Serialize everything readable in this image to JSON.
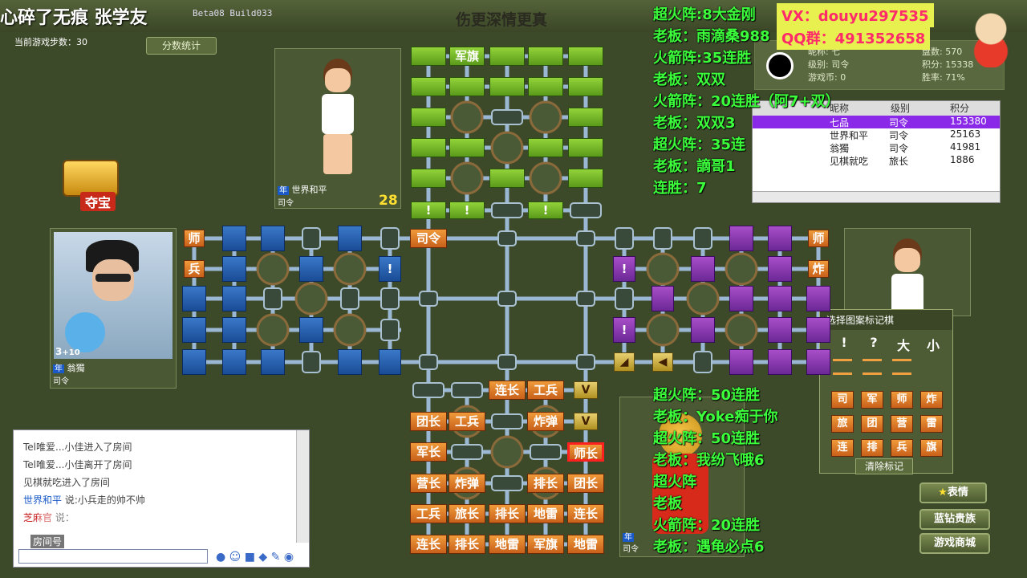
{
  "window": {
    "title_overlay": "心碎了无痕 张学友",
    "build": "Beta08 Build033",
    "slogan": "伤更深情更真"
  },
  "game": {
    "steps_label": "当前游戏步数：",
    "steps_value": "30",
    "score_button": "分数统计",
    "treasure_label": "夺宝"
  },
  "players": {
    "top": {
      "rank": "司令",
      "name": "世界和平",
      "badge": "年",
      "count": "28"
    },
    "left": {
      "rank": "司令",
      "name": "翁獨",
      "badge": "年",
      "level": "3",
      "plus": "+10"
    },
    "bottom": {
      "rank": "司令",
      "badge": "年"
    }
  },
  "profile": {
    "nick_label": "昵称",
    "rank_label": "级别",
    "rank_value": "司令",
    "coins_label": "游戏币",
    "coins_value": "0",
    "games_label": "盘数",
    "games_value": "570",
    "score_label": "积分",
    "score_value": "15338",
    "win_label": "胜率",
    "win_value": "71%",
    "badge_text": "七"
  },
  "player_list": {
    "headers": [
      "昵称",
      "级别",
      "积分"
    ],
    "rows": [
      {
        "name": "七品",
        "rank": "司令",
        "score": "153380"
      },
      {
        "name": "世界和平",
        "rank": "司令",
        "score": "25163"
      },
      {
        "name": "翁獨",
        "rank": "司令",
        "score": "41981"
      },
      {
        "name": "见棋就吃",
        "rank": "旅长",
        "score": "1886"
      }
    ]
  },
  "promo": {
    "vx": "VX：douyu297535",
    "qq": "QQ群：491352658"
  },
  "overlay_top": [
    "超火阵:8大金刚",
    "老板：雨滴桑988",
    "火箭阵:35连胜",
    "老板：双双",
    "火箭阵：20连胜（阿7+双）",
    "老板：双双3",
    "超火阵：35连",
    "老板：謫哥1",
    "连胜：7"
  ],
  "overlay_bottom": [
    "超火阵：50连胜",
    "老板：Yoke痴于你",
    "超火阵：50连胜",
    "老板：我纷飞哦6",
    "超火阵",
    "老板",
    "火箭阵：20连胜",
    "老板：遇龟必点6"
  ],
  "board": {
    "top_labels": {
      "flag": "军旗"
    },
    "marks": {
      "exclaim": "!",
      "question": "?"
    },
    "center_piece": "司令",
    "left_pieces": [
      "师",
      "兵"
    ],
    "right_pieces": [
      "师",
      "炸"
    ],
    "bottom_rows": [
      [
        "",
        "",
        "连长",
        "工兵",
        "v"
      ],
      [
        "团长",
        "工兵",
        "",
        "炸弹",
        "v"
      ],
      [
        "军长",
        "",
        "",
        "",
        "师长"
      ],
      [
        "营长",
        "炸弹",
        "",
        "排长",
        "团长"
      ],
      [
        "工兵",
        "旅长",
        "排长",
        "地雷",
        "连长"
      ],
      [
        "连长",
        "排长",
        "地雷",
        "军旗",
        "地雷"
      ]
    ]
  },
  "mark_panel": {
    "title": "选择图案标记棋",
    "row1": [
      "!",
      "?",
      "大",
      "小"
    ],
    "pieces": [
      "司",
      "军",
      "师",
      "炸",
      "旅",
      "团",
      "营",
      "雷",
      "连",
      "排",
      "兵",
      "旗"
    ],
    "clear": "清除标记"
  },
  "chat": {
    "lines": [
      "Tel唯爱...小佳进入了房间",
      "Tel唯爱...小佳离开了房间",
      "见棋就吃进入了房间"
    ],
    "msg1_name": "世界和平",
    "msg1_text": "说:小兵走的帅不帅",
    "msg2_name": "芝麻官",
    "msg2_text": "说：",
    "room_label": "房间号"
  },
  "buttons": {
    "emoji": "表情",
    "diamond": "蓝钻贵族",
    "shop": "游戏商城"
  }
}
